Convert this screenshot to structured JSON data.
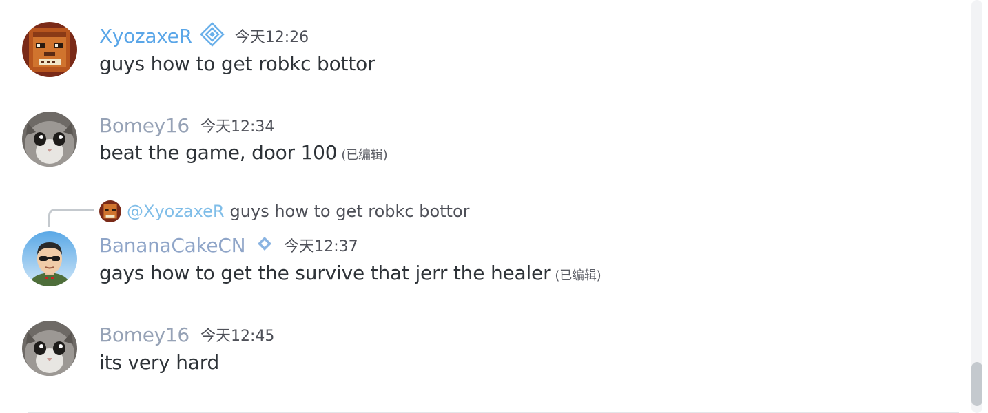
{
  "messages": [
    {
      "username": "XyozaxeR",
      "name_color": "#5aa6e8",
      "timestamp": "今天12:26",
      "content": "guys how to get robkc bottor",
      "edited": "",
      "avatar_icon": "pixel-face-avatar",
      "badge_icon": "diamond-badge-icon"
    },
    {
      "username": "Bomey16",
      "name_color": "#96a2b6",
      "timestamp": "今天12:34",
      "content": "beat the game, door 100",
      "edited": "(已编辑)",
      "avatar_icon": "cat-avatar"
    },
    {
      "reply": {
        "mention": "@XyozaxeR",
        "text": "guys how to get robkc bottor"
      },
      "username": "BananaCakeCN",
      "name_color": "#8fa5c8",
      "timestamp": "今天12:37",
      "content": "gays how to get the survive that jerr the healer",
      "edited": "(已编辑)",
      "avatar_icon": "man-sunglasses-avatar",
      "badge_icon": "small-diamond-badge-icon"
    },
    {
      "username": "Bomey16",
      "name_color": "#96a2b6",
      "timestamp": "今天12:45",
      "content": "its very hard",
      "edited": "",
      "avatar_icon": "cat-avatar"
    }
  ]
}
